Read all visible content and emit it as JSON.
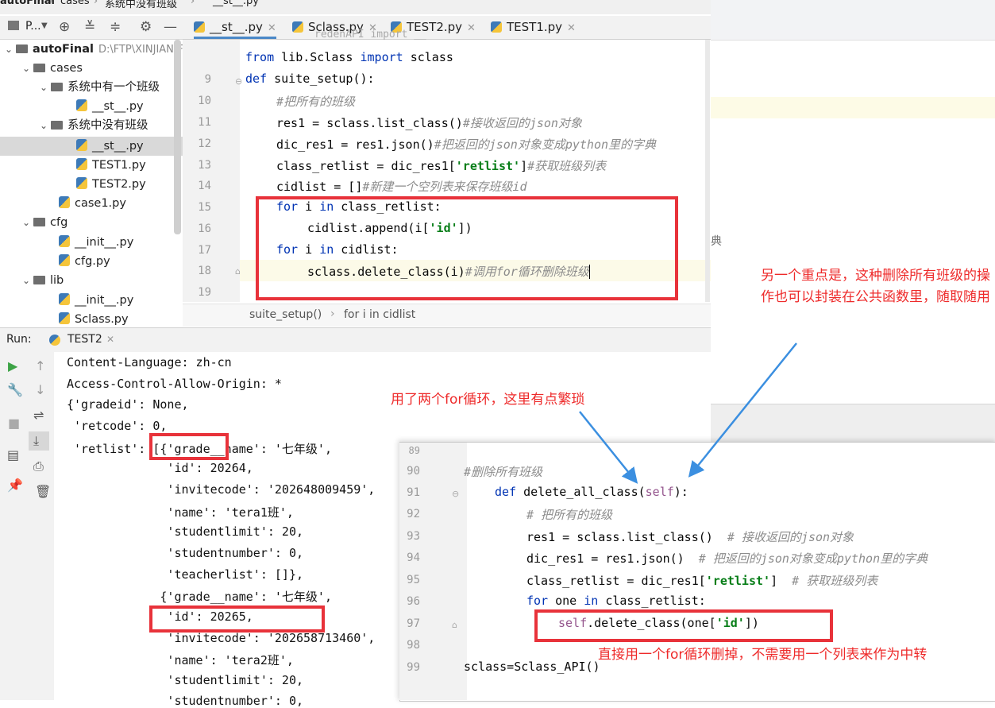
{
  "breadcrumb": [
    "autoFinal",
    "cases",
    "系统中没有班级",
    "__st__.py"
  ],
  "tabs": [
    {
      "label": "__st__.py",
      "active": true
    },
    {
      "label": "Sclass.py"
    },
    {
      "label": "TEST2.py"
    },
    {
      "label": "TEST1.py"
    }
  ],
  "project_toolbar": {
    "label": "P..."
  },
  "tree": {
    "root": {
      "name": "autoFinal",
      "path": "D:\\FTP\\XINJIAN\\FinalProject\\autoFinal"
    },
    "items": [
      "cases",
      "系统中有一个班级",
      "__st__.py",
      "系统中没有班级",
      "__st__.py",
      "TEST1.py",
      "TEST2.py",
      "case1.py",
      "cfg",
      "__init__.py",
      "cfg.py",
      "lib",
      "__init__.py",
      "Sclass.py"
    ]
  },
  "editor": {
    "partial_top": "redenAPI import __",
    "line_numbers": [
      "9",
      "10",
      "11",
      "12",
      "13",
      "14",
      "15",
      "16",
      "17",
      "18",
      "19"
    ],
    "lines": {
      "l0": {
        "kw": "from",
        "a": " lib.Sclass ",
        "kw2": "import",
        "b": " sclass"
      },
      "l9": {
        "kw": "def",
        "a": " suite_setup():"
      },
      "l10": {
        "c": "#把所有的班级"
      },
      "l11": {
        "a": "res1 = sclass.list_class()",
        "c": "#接收返回的json对象"
      },
      "l12": {
        "a": "dic_res1 = res1.json()",
        "c": "#把返回的json对象变成python里的字典"
      },
      "l13": {
        "a": "class_retlist = dic_res1[",
        "s": "'retlist'",
        "b": "]",
        "c": "#获取班级列表"
      },
      "l14": {
        "a": "cidlist = []",
        "c": "#新建一个空列表来保存班级id"
      },
      "l15": {
        "kw": "for",
        "a": " i ",
        "kw2": "in",
        "b": " class_retlist:"
      },
      "l16": {
        "a": "cidlist.append(i[",
        "s": "'id'",
        "b": "])"
      },
      "l17": {
        "kw": "for",
        "a": " i ",
        "kw2": "in",
        "b": " cidlist:"
      },
      "l18": {
        "a": "sclass.delete_class(i)",
        "c": "#调用for循环删除班级"
      }
    },
    "breadcrumbs": [
      "suite_setup()",
      "for i in cidlist"
    ]
  },
  "run": {
    "label": "Run:",
    "tab": "TEST2",
    "console": [
      "Content-Language: zh-cn",
      "Access-Control-Allow-Origin: *",
      "{'gradeid': None,",
      " 'retcode': 0,",
      " 'retlist': [{'grade__name': '七年级',",
      "              'id': 20264,",
      "              'invitecode': '202648009459',",
      "              'name': 'tera1班',",
      "              'studentlimit': 20,",
      "              'studentnumber': 0,",
      "              'teacherlist': []},",
      "             {'grade__name': '七年级',",
      "              'id': 20265,",
      "              'invitecode': '202658713460',",
      "              'name': 'tera2班',",
      "              'studentlimit': 20,",
      "              'studentnumber': 0,"
    ]
  },
  "overlay": {
    "line_numbers": [
      "89",
      "90",
      "91",
      "92",
      "93",
      "94",
      "95",
      "96",
      "97",
      "98",
      "99"
    ],
    "lines": {
      "l90": {
        "c": "#删除所有班级"
      },
      "l91": {
        "kw": "def",
        "a": " delete_all_class(",
        "self": "self",
        "b": "):"
      },
      "l92": {
        "c": "# 把所有的班级"
      },
      "l93": {
        "a": "res1 = sclass.list_class()  ",
        "c": "# 接收返回的json对象"
      },
      "l94": {
        "a": "dic_res1 = res1.json()  ",
        "c": "# 把返回的json对象变成python里的字典"
      },
      "l95": {
        "a": "class_retlist = dic_res1[",
        "s": "'retlist'",
        "b": "]  ",
        "c": "# 获取班级列表"
      },
      "l96": {
        "kw": "for",
        "a": " one ",
        "kw2": "in",
        "b": " class_retlist:"
      },
      "l97": {
        "self": "self",
        "a": ".delete_class(one[",
        "s": "'id'",
        "b": "])"
      },
      "l99": {
        "a": "sclass=Sclass_API()"
      }
    }
  },
  "background_fragment": "典",
  "annotations": {
    "right_note": "另一个重点是，这种删除所有班级的操作也可以封装在公共函数里，随取随用",
    "for_note": "用了两个for循环，这里有点繁琐",
    "bottom_note": "直接用一个for循环删掉，不需要用一个列表来作为中转"
  },
  "colors": {
    "annotation_red": "#ee2a2a",
    "box_red": "#e8323a",
    "arrow_blue": "#3b8fe0",
    "keyword": "#0033b3",
    "comment": "#8c8c8c",
    "string": "#067d17"
  }
}
